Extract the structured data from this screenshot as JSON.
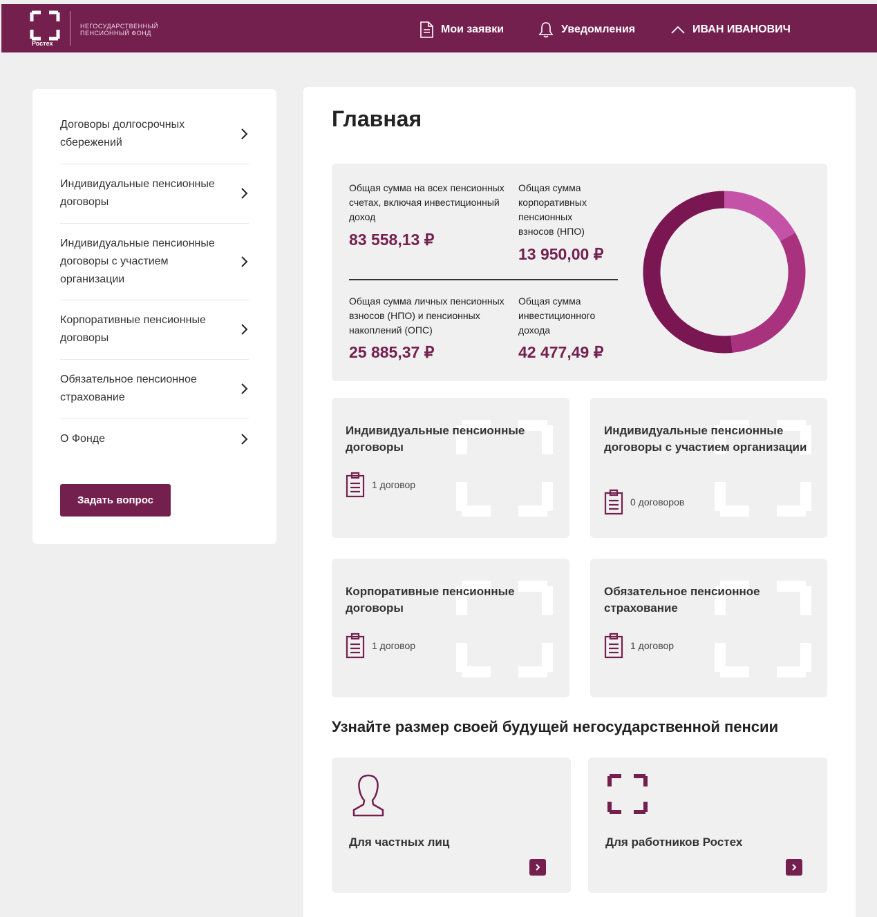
{
  "header": {
    "logo_caption": "Ростех",
    "fund_name": "НЕГОСУДАРСТВЕННЫЙ ПЕНСИОННЫЙ ФОНД",
    "nav": {
      "requests": "Мои заявки",
      "notifications": "Уведомления",
      "user": "ИВАН ИВАНОВИЧ"
    }
  },
  "sidebar": {
    "items": [
      {
        "label": "Договоры долгосрочных сбережений"
      },
      {
        "label": "Индивидуальные пенсионные договоры"
      },
      {
        "label": "Индивидуальные пенсионные договоры с участием организации"
      },
      {
        "label": "Корпоративные пенсионные договоры"
      },
      {
        "label": "Обязательное пенсионное страхование"
      },
      {
        "label": "О Фонде"
      }
    ],
    "ask_button": "Задать вопрос"
  },
  "main": {
    "title": "Главная",
    "summary": {
      "total_label": "Общая сумма на всех пенсионных счетах, включая инвестиционный доход",
      "total_value": "83 558,13 ₽",
      "corporate_label": "Общая сумма корпоративных пенсионных взносов (НПО)",
      "corporate_value": "13 950,00 ₽",
      "personal_label": "Общая сумма личных пенсионных взносов (НПО) и пенсионных накоплений (ОПС)",
      "personal_value": "25 885,37 ₽",
      "investment_label": "Общая сумма инвестиционного дохода",
      "investment_value": "42 477,49 ₽"
    },
    "cards": [
      {
        "title": "Индивидуальные пенсионные договоры",
        "count": "1 договор"
      },
      {
        "title": "Индивидуальные пенсионные договоры с участием организации",
        "count": "0 договоров"
      },
      {
        "title": "Корпоративные пенсионные договоры",
        "count": "1 договор"
      },
      {
        "title": "Обязательное пенсионное страхование",
        "count": "1 договор"
      }
    ],
    "section_title": "Узнайте размер своей будущей негосударственной пенсии",
    "calculators": [
      {
        "label": "Для частных лиц",
        "icon": "person-icon"
      },
      {
        "label": "Для работников Ростех",
        "icon": "rostec-frame-icon"
      }
    ]
  },
  "colors": {
    "brand": "#74204f",
    "donut_dark": "#7a1652",
    "donut_mid": "#a8327e",
    "donut_light": "#c453a8"
  },
  "chart_data": {
    "type": "pie",
    "values": [
      13950.0,
      25885.37,
      42477.49
    ],
    "colors": [
      "#c453a8",
      "#a8327e",
      "#7a1652"
    ]
  }
}
